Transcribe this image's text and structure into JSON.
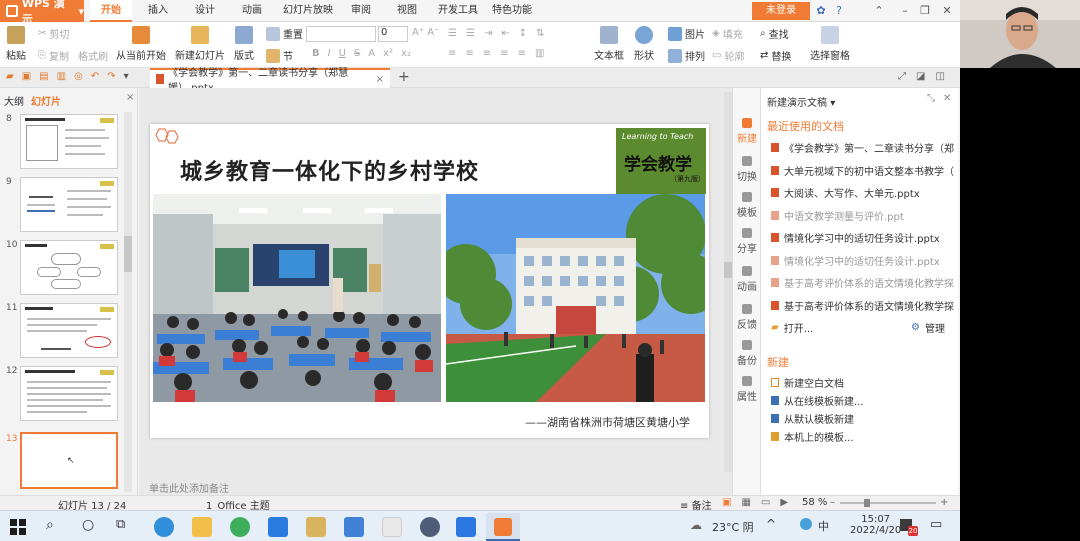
{
  "app": {
    "name": "WPS 演示",
    "login": "未登录"
  },
  "menu_tabs": [
    "开始",
    "插入",
    "设计",
    "动画",
    "幻灯片放映",
    "审阅",
    "视图",
    "开发工具",
    "特色功能"
  ],
  "ribbon": {
    "paste": "粘贴",
    "cut": "剪切",
    "copy": "复制",
    "format_painter": "格式刷",
    "from_current": "从当前开始",
    "new_slide": "新建幻灯片",
    "layout": "版式",
    "section": "节",
    "reset": "重置",
    "font_size": "0",
    "bold": "B",
    "italic": "I",
    "underline": "U",
    "strike": "S",
    "textbox": "文本框",
    "shape": "形状",
    "picture": "图片",
    "arrange": "排列",
    "fill": "填充",
    "outline": "轮廓",
    "find": "查找",
    "replace": "替换",
    "select_pane": "选择窗格"
  },
  "document": {
    "tab_title": "《学会教学》第一、二章读书分享（郑慧媛）.pptx"
  },
  "left_panel": {
    "tab_outline": "大纲",
    "tab_slides": "幻灯片",
    "slide_numbers": [
      "8",
      "9",
      "10",
      "11",
      "12",
      "13"
    ]
  },
  "slide": {
    "title": "城乡教育一体化下的乡村学校",
    "caption": "——湖南省株洲市荷塘区黄塘小学",
    "book_en": "Learning to Teach",
    "book_cn": "学会教学",
    "book_ed": "（第九版）"
  },
  "notes_placeholder": "单击此处添加备注",
  "right_icons": [
    "新建",
    "切换",
    "模板",
    "分享",
    "动画",
    "反馈",
    "备份",
    "属性"
  ],
  "task_pane": {
    "header": "新建演示文稿",
    "recent_title": "最近使用的文档",
    "recent": [
      {
        "name": "《学会教学》第一、二章读书分享（郑...",
        "dim": false
      },
      {
        "name": "大单元视域下的初中语文整本书教学（...",
        "dim": false
      },
      {
        "name": "大阅读、大写作、大单元.pptx",
        "dim": false
      },
      {
        "name": "中语文教学测量与评价.ppt",
        "dim": true
      },
      {
        "name": "情境化学习中的适切任务设计.pptx",
        "dim": false
      },
      {
        "name": "情境化学习中的适切任务设计.pptx",
        "dim": true
      },
      {
        "name": "基于高考评价体系的语文情境化教学探...",
        "dim": true
      },
      {
        "name": "基于高考评价体系的语文情境化教学探...",
        "dim": false
      }
    ],
    "open": "打开...",
    "manage": "管理",
    "new_title": "新建",
    "new_items": [
      "新建空白文档",
      "从在线模板新建...",
      "从默认模板新建",
      "本机上的模板..."
    ]
  },
  "status": {
    "slide_counter": "幻灯片 13 / 24",
    "theme": "1_Office 主题",
    "notes": "备注",
    "zoom": "58 %"
  },
  "taskbar": {
    "weather": "23°C 阴",
    "ime": "中",
    "time": "15:07",
    "date": "2022/4/20",
    "notif_count": "20"
  },
  "colors": {
    "accent": "#f07b34",
    "brand_blue": "#3d6fb6"
  }
}
